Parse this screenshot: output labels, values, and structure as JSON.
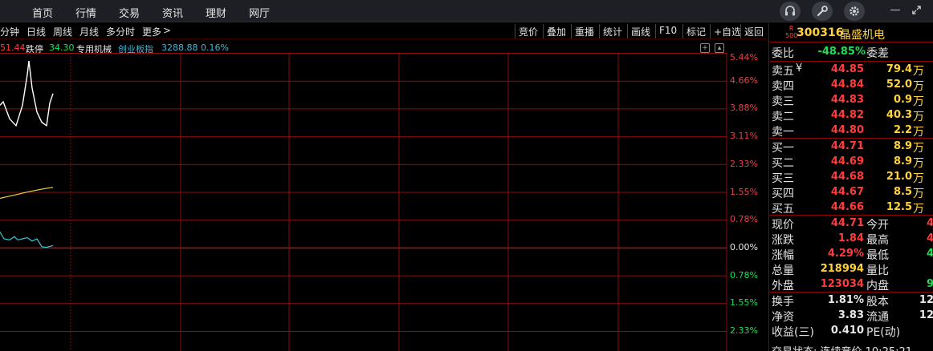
{
  "topbar": {
    "menu": [
      "首页",
      "行情",
      "交易",
      "资讯",
      "理财",
      "网厅"
    ],
    "icons": [
      "headset-icon",
      "wrench-icon",
      "gear-icon"
    ],
    "window_controls": [
      "—",
      "↗",
      "↙"
    ]
  },
  "chart_toolbar": {
    "periods": [
      "分钟",
      "日线",
      "周线",
      "月线",
      "多分时",
      "更多"
    ],
    "more_arrow": ">",
    "tools": [
      "竞价",
      "叠加",
      "重播",
      "统计",
      "画线",
      "F10",
      "标记",
      "+自选",
      "返回"
    ]
  },
  "info_row": {
    "t1": "51.44",
    "t2": "跌停",
    "t3": "34.30",
    "t4": "专用机械",
    "t5": "创业板指",
    "t6": "3288.88",
    "t7": "0.16%"
  },
  "chart": {
    "pct_labels": [
      "5.44%",
      "4.66%",
      "3.88%",
      "3.11%",
      "2.33%",
      "1.55%",
      "0.78%",
      "0.00%",
      "0.78%",
      "1.55%",
      "2.33%"
    ],
    "price_line": [
      [
        0,
        0.65
      ],
      [
        4,
        0.6
      ],
      [
        12,
        0.85
      ],
      [
        20,
        0.95
      ],
      [
        28,
        0.65
      ],
      [
        34,
        0.2
      ],
      [
        36,
        0.0
      ],
      [
        40,
        0.4
      ],
      [
        46,
        0.75
      ],
      [
        52,
        0.9
      ],
      [
        58,
        0.95
      ],
      [
        62,
        0.62
      ],
      [
        66,
        0.48
      ]
    ],
    "avg_line": [
      [
        0,
        0.96
      ],
      [
        10,
        0.9
      ],
      [
        20,
        0.84
      ],
      [
        30,
        0.78
      ],
      [
        40,
        0.72
      ],
      [
        48,
        0.68
      ],
      [
        56,
        0.64
      ],
      [
        66,
        0.6
      ]
    ],
    "sub_line": [
      [
        0,
        0.2
      ],
      [
        5,
        0.5
      ],
      [
        12,
        0.55
      ],
      [
        18,
        0.4
      ],
      [
        22,
        0.55
      ],
      [
        28,
        0.5
      ],
      [
        34,
        0.45
      ],
      [
        40,
        0.6
      ],
      [
        46,
        0.5
      ],
      [
        52,
        0.85
      ],
      [
        58,
        0.88
      ],
      [
        66,
        0.8
      ]
    ]
  },
  "panel": {
    "r_tag_top": "R",
    "r_tag_bottom": "500",
    "code": "300316",
    "name": "晶盛机电",
    "weibi_label": "委比",
    "weibi_value": "-48.85%",
    "weicha_label": "委差",
    "asks": [
      {
        "label": "卖五",
        "mark": "¥",
        "price": "44.85",
        "vol": "79.4",
        "unit": "万"
      },
      {
        "label": "卖四",
        "mark": "",
        "price": "44.84",
        "vol": "52.0",
        "unit": "万"
      },
      {
        "label": "卖三",
        "mark": "",
        "price": "44.83",
        "vol": "0.9",
        "unit": "万"
      },
      {
        "label": "卖二",
        "mark": "",
        "price": "44.82",
        "vol": "40.3",
        "unit": "万"
      },
      {
        "label": "卖一",
        "mark": "",
        "price": "44.80",
        "vol": "2.2",
        "unit": "万"
      }
    ],
    "bids": [
      {
        "label": "买一",
        "price": "44.71",
        "vol": "8.9",
        "unit": "万"
      },
      {
        "label": "买二",
        "price": "44.69",
        "vol": "8.9",
        "unit": "万"
      },
      {
        "label": "买三",
        "price": "44.68",
        "vol": "21.0",
        "unit": "万"
      },
      {
        "label": "买四",
        "price": "44.67",
        "vol": "8.5",
        "unit": "万"
      },
      {
        "label": "买五",
        "price": "44.66",
        "vol": "12.5",
        "unit": "万"
      }
    ],
    "stats": [
      {
        "l1": "现价",
        "v1": "44.71",
        "c1": "red",
        "l2": "今开",
        "v2": "4",
        "c2": "red"
      },
      {
        "l1": "涨跌",
        "v1": "1.84",
        "c1": "red",
        "l2": "最高",
        "v2": "4",
        "c2": "red"
      },
      {
        "l1": "涨幅",
        "v1": "4.29%",
        "c1": "red",
        "l2": "最低",
        "v2": "4",
        "c2": "green"
      },
      {
        "l1": "总量",
        "v1": "218994",
        "c1": "yellow",
        "l2": "量比",
        "v2": "",
        "c2": "white"
      },
      {
        "l1": "外盘",
        "v1": "123034",
        "c1": "red",
        "l2": "内盘",
        "v2": "9",
        "c2": "green"
      }
    ],
    "stats2": [
      {
        "l1": "换手",
        "v1": "1.81%",
        "l2": "股本",
        "v2": "12"
      },
      {
        "l1": "净资",
        "v1": "3.83",
        "l2": "流通",
        "v2": "12"
      },
      {
        "l1": "收益(三)",
        "v1": "0.410",
        "l2": "PE(动)",
        "v2": ""
      }
    ],
    "status_text": "交易状态: 连续竞价 10:25:21"
  }
}
